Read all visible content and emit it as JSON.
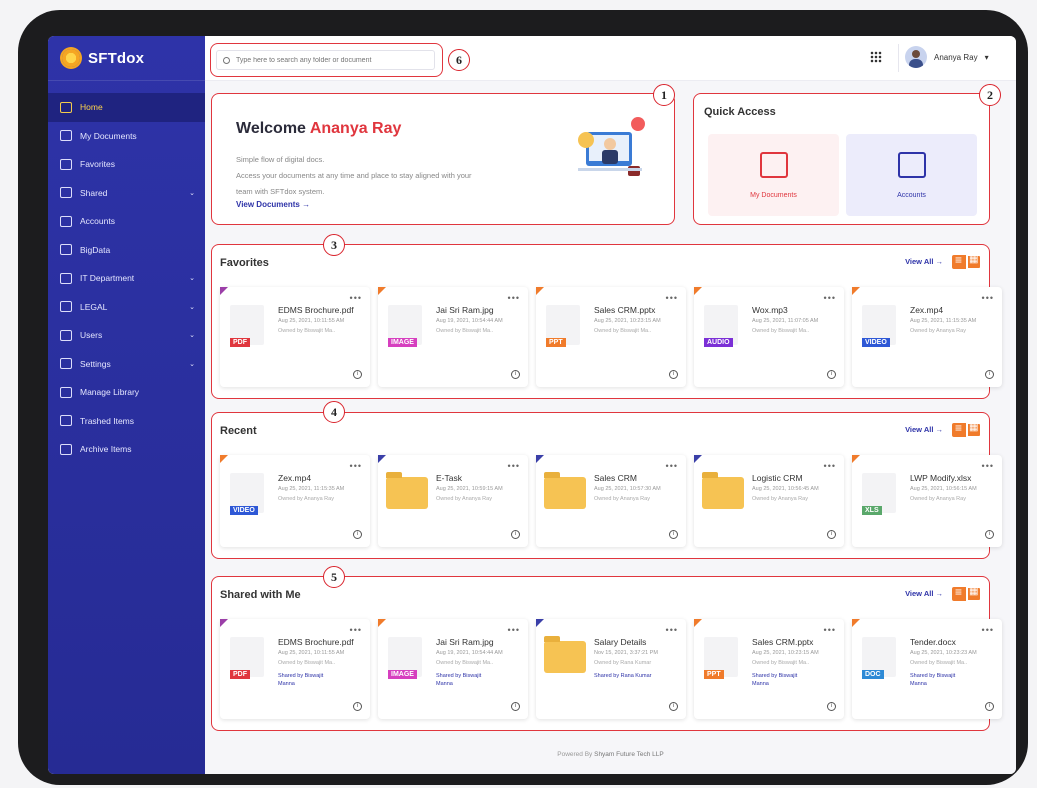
{
  "brand": {
    "name": "SFTdox"
  },
  "sidebar": {
    "items": [
      {
        "label": "Home",
        "caret": ""
      },
      {
        "label": "My Documents",
        "caret": ""
      },
      {
        "label": "Favorites",
        "caret": ""
      },
      {
        "label": "Shared",
        "caret": "⌄"
      },
      {
        "label": "Accounts",
        "caret": ""
      },
      {
        "label": "BigData",
        "caret": ""
      },
      {
        "label": "IT Department",
        "caret": "⌄"
      },
      {
        "label": "LEGAL",
        "caret": "⌄"
      },
      {
        "label": "Users",
        "caret": "⌄"
      },
      {
        "label": "Settings",
        "caret": "⌄"
      },
      {
        "label": "Manage Library",
        "caret": ""
      },
      {
        "label": "Trashed Items",
        "caret": ""
      },
      {
        "label": "Archive Items",
        "caret": ""
      }
    ]
  },
  "search": {
    "placeholder": "Type here to search any folder or document"
  },
  "user": {
    "name": "Ananya Ray",
    "caret": "▾"
  },
  "markers": [
    "1",
    "2",
    "3",
    "4",
    "5",
    "6"
  ],
  "welcome": {
    "prefix": "Welcome",
    "name": "Ananya Ray",
    "line1": "Simple flow of digital docs.",
    "line2": "Access your documents at any time and place to stay aligned with your",
    "line3": "team with SFTdox system.",
    "link": "View Documents →"
  },
  "quick_access": {
    "title": "Quick Access",
    "docs_label": "My Documents",
    "accounts_label": "Accounts"
  },
  "favorites": {
    "title": "Favorites",
    "view_all": "View All →",
    "cards": [
      {
        "name": "EDMS Brochure.pdf",
        "date": "Aug 25, 2021, 10:11:55 AM",
        "owner": "Owned by Biswajit Ma..",
        "tag": "PDF"
      },
      {
        "name": "Jai Sri Ram.jpg",
        "date": "Aug 19, 2021, 10:54:44 AM",
        "owner": "Owned by Biswajit Ma..",
        "tag": "IMAGE"
      },
      {
        "name": "Sales CRM.pptx",
        "date": "Aug 25, 2021, 10:23:15 AM",
        "owner": "Owned by Biswajit Ma..",
        "tag": "PPT"
      },
      {
        "name": "Wox.mp3",
        "date": "Aug 25, 2021, 11:07:05 AM",
        "owner": "Owned by Biswajit Ma..",
        "tag": "AUDIO"
      },
      {
        "name": "Zex.mp4",
        "date": "Aug 25, 2021, 11:15:35 AM",
        "owner": "Owned by Ananya Ray",
        "tag": "VIDEO"
      }
    ]
  },
  "recent": {
    "title": "Recent",
    "view_all": "View All →",
    "cards": [
      {
        "name": "Zex.mp4",
        "date": "Aug 25, 2021, 11:15:35 AM",
        "owner": "Owned by Ananya Ray",
        "tag": "VIDEO"
      },
      {
        "name": "E-Task",
        "date": "Aug 25, 2021, 10:59:15 AM",
        "owner": "Owned by Ananya Ray",
        "tag": ""
      },
      {
        "name": "Sales CRM",
        "date": "Aug 25, 2021, 10:57:30 AM",
        "owner": "Owned by Ananya Ray",
        "tag": ""
      },
      {
        "name": "Logistic CRM",
        "date": "Aug 25, 2021, 10:56:45 AM",
        "owner": "Owned by Ananya Ray",
        "tag": ""
      },
      {
        "name": "LWP Modify.xlsx",
        "date": "Aug 25, 2021, 10:56:15 AM",
        "owner": "Owned by Ananya Ray",
        "tag": "XLS"
      }
    ]
  },
  "shared": {
    "title": "Shared with Me",
    "view_all": "View All →",
    "cards": [
      {
        "name": "EDMS Brochure.pdf",
        "date": "Aug 25, 2021, 10:11:55 AM",
        "owner": "Owned by Biswajit Ma..",
        "shared": "Shared by Biswajit Manna",
        "tag": "PDF"
      },
      {
        "name": "Jai Sri Ram.jpg",
        "date": "Aug 19, 2021, 10:54:44 AM",
        "owner": "Owned by Biswajit Ma..",
        "shared": "Shared by Biswajit Manna",
        "tag": "IMAGE"
      },
      {
        "name": "Salary Details",
        "date": "Nov 15, 2021, 3:37:21 PM",
        "owner": "Owned by Rana Kumar",
        "shared": "Shared by Rana Kumar",
        "tag": ""
      },
      {
        "name": "Sales CRM.pptx",
        "date": "Aug 25, 2021, 10:23:15 AM",
        "owner": "Owned by Biswajit Ma..",
        "shared": "Shared by Biswajit Manna",
        "tag": "PPT"
      },
      {
        "name": "Tender.docx",
        "date": "Aug 25, 2021, 10:23:23 AM",
        "owner": "Owned by Biswajit Ma..",
        "shared": "Shared by Biswajit Manna",
        "tag": "DOC"
      }
    ]
  },
  "footer": {
    "prefix": "Powered By",
    "company": "Shyam Future Tech LLP"
  },
  "colors": {
    "sidebar": "#2e33a8",
    "accent": "#e0363e",
    "orange": "#f07b2b",
    "pdf": "#e0363e",
    "image": "#d63fbf",
    "ppt": "#f07b2b",
    "audio": "#7b2fd6",
    "video": "#2e58d6",
    "xls": "#5aa86b",
    "doc": "#2e8ad6"
  }
}
